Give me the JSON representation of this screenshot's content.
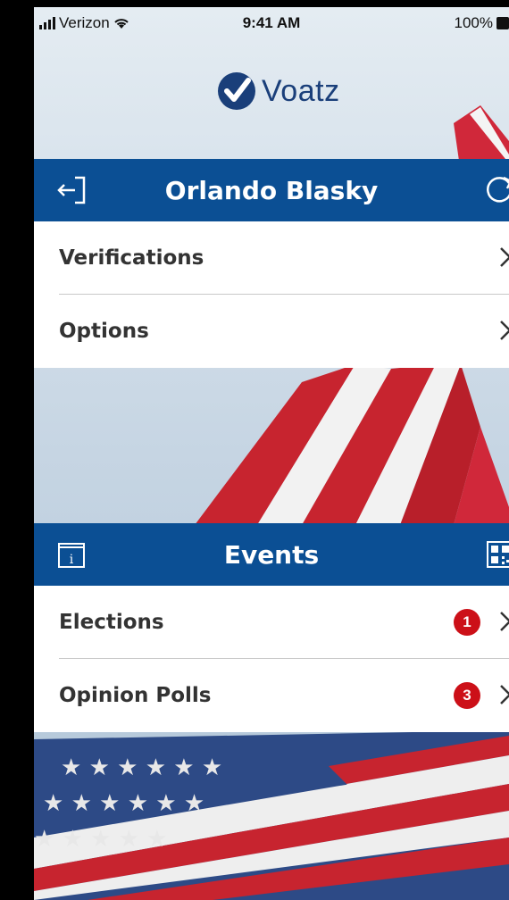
{
  "status_bar": {
    "carrier": "Verizon",
    "time": "9:41 AM",
    "battery": "100%"
  },
  "app": {
    "logo_text": "Voatz"
  },
  "profile_bar": {
    "title": "Orlando Blasky",
    "left_icon": "sign-out-icon",
    "right_icon": "refresh-icon"
  },
  "profile_menu": [
    {
      "label": "Verifications"
    },
    {
      "label": "Options"
    }
  ],
  "events_bar": {
    "title": "Events",
    "left_icon": "info-icon",
    "right_icon": "qr-code-icon"
  },
  "events_menu": [
    {
      "label": "Elections",
      "badge": "1"
    },
    {
      "label": "Opinion Polls",
      "badge": "3"
    }
  ],
  "colors": {
    "primary": "#0b4f94",
    "badge": "#cc1018",
    "logo": "#1a3f7a"
  }
}
